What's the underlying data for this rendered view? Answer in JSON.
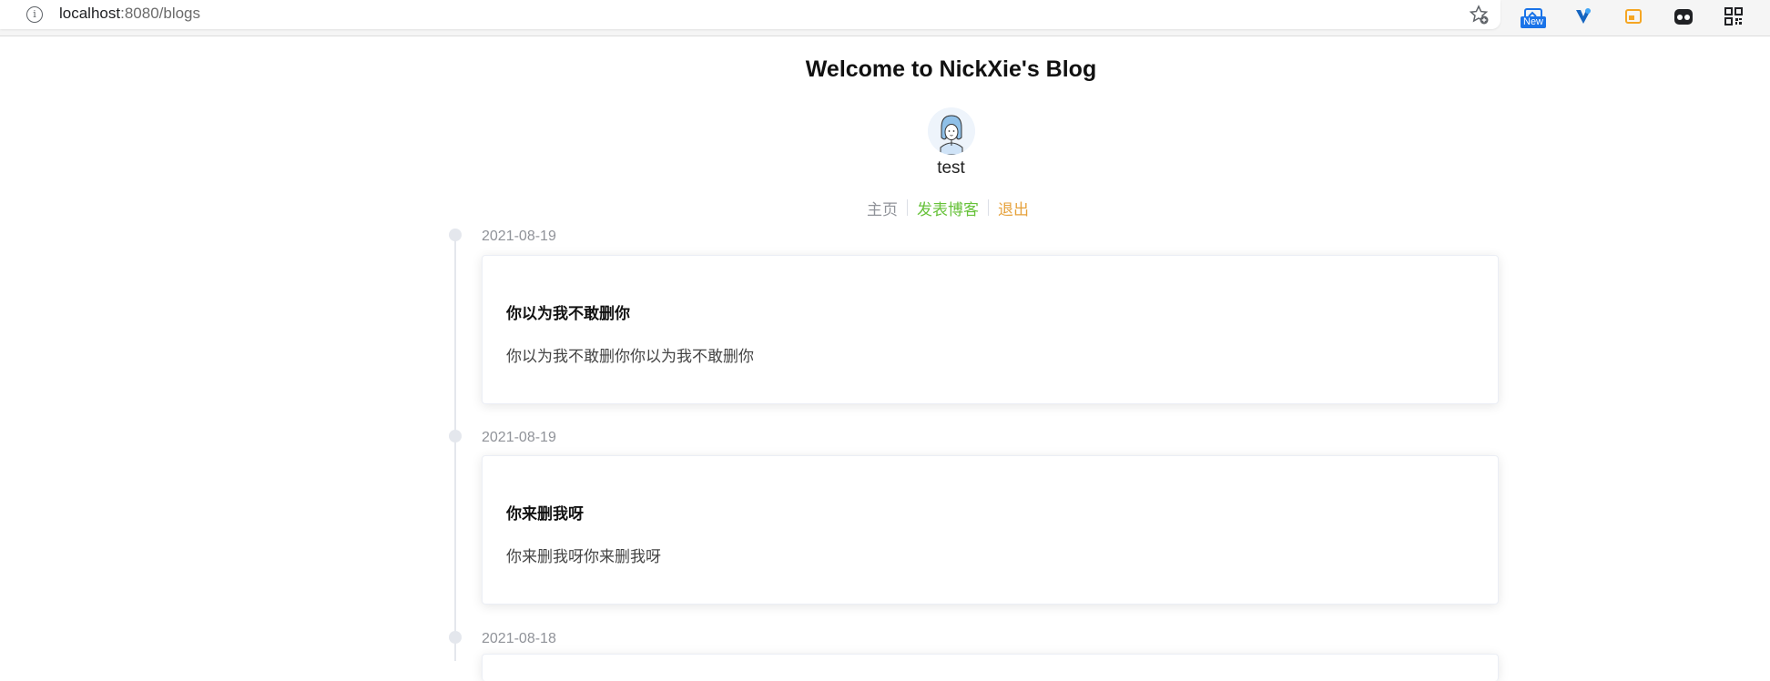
{
  "browser": {
    "url_host": "localhost",
    "url_rest": ":8080/blogs",
    "extensions": [
      "new-badge-extension-icon",
      "v-extension-icon",
      "orange-extension-icon",
      "spy-extension-icon",
      "qr-code-icon"
    ],
    "new_badge": "New"
  },
  "header": {
    "title": "Welcome to NickXie's Blog",
    "username": "test"
  },
  "nav": {
    "home": "主页",
    "publish": "发表博客",
    "logout": "退出",
    "colors": {
      "home": "#909399",
      "publish": "#67c23a",
      "logout": "#e6a23c"
    }
  },
  "blogs": [
    {
      "date": "2021-08-19",
      "title": "你以为我不敢删你",
      "description": "你以为我不敢删你你以为我不敢删你"
    },
    {
      "date": "2021-08-19",
      "title": "你来删我呀",
      "description": "你来删我呀你来删我呀"
    },
    {
      "date": "2021-08-18",
      "title": "",
      "description": ""
    }
  ]
}
